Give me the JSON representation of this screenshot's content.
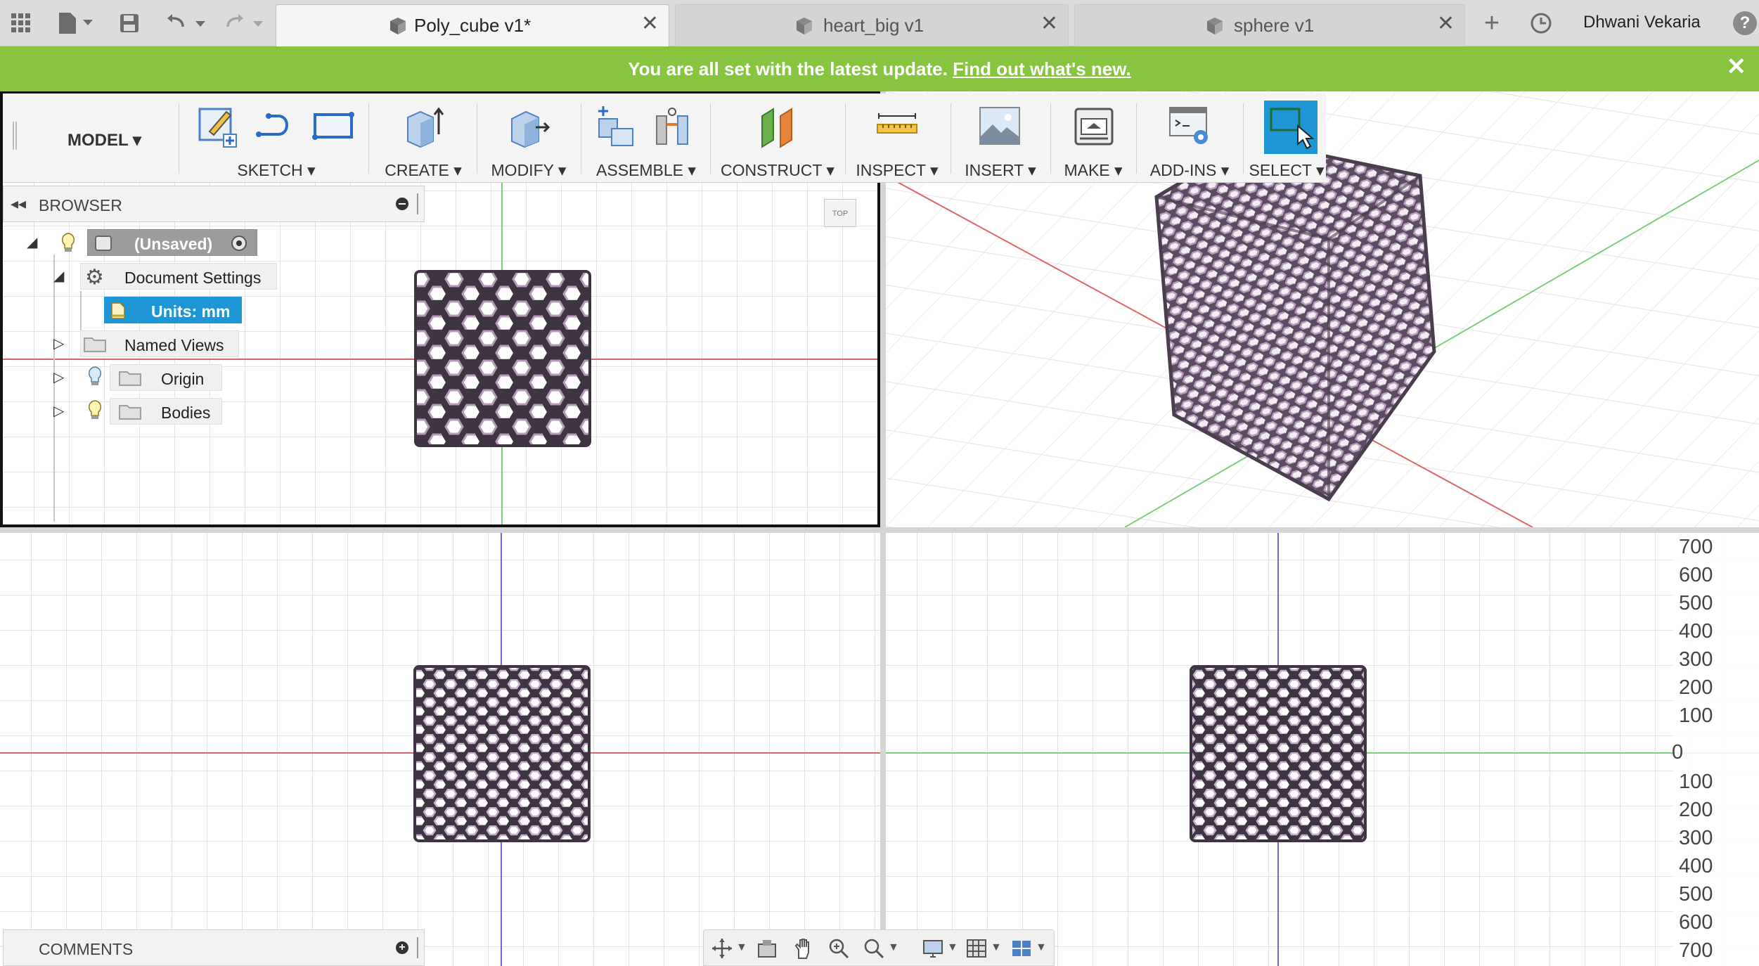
{
  "tabs": [
    {
      "label": "Poly_cube v1*",
      "active": true
    },
    {
      "label": "heart_big v1",
      "active": false
    },
    {
      "label": "sphere v1",
      "active": false
    }
  ],
  "user": {
    "name": "Dhwani Vekaria"
  },
  "banner": {
    "message": "You are all set with the latest update.",
    "link": "Find out what's new."
  },
  "toolbar": {
    "workspace": "MODEL",
    "groups": [
      "SKETCH",
      "CREATE",
      "MODIFY",
      "ASSEMBLE",
      "CONSTRUCT",
      "INSPECT",
      "INSERT",
      "MAKE",
      "ADD-INS",
      "SELECT"
    ]
  },
  "browser": {
    "title": "BROWSER",
    "items": [
      {
        "label": "(Unsaved)"
      },
      {
        "label": "Document Settings"
      },
      {
        "label": "Units: mm"
      },
      {
        "label": "Named Views"
      },
      {
        "label": "Origin"
      },
      {
        "label": "Bodies"
      }
    ]
  },
  "viewcube": {
    "label": "TOP"
  },
  "comments": {
    "title": "COMMENTS"
  },
  "ruler": {
    "labels": [
      "700",
      "600",
      "500",
      "400",
      "300",
      "200",
      "100",
      "0",
      "100",
      "200",
      "300",
      "400",
      "500",
      "600",
      "700"
    ]
  },
  "colors": {
    "banner": "#87c540",
    "lattice": "#b39bb8",
    "lattice_edge": "#4a3d4d",
    "select_accent": "#1e96d6",
    "grid": "#e2e2e2",
    "axis_red": "#e06666",
    "axis_green": "#7bd07b",
    "axis_blue": "#6b6bd8"
  }
}
